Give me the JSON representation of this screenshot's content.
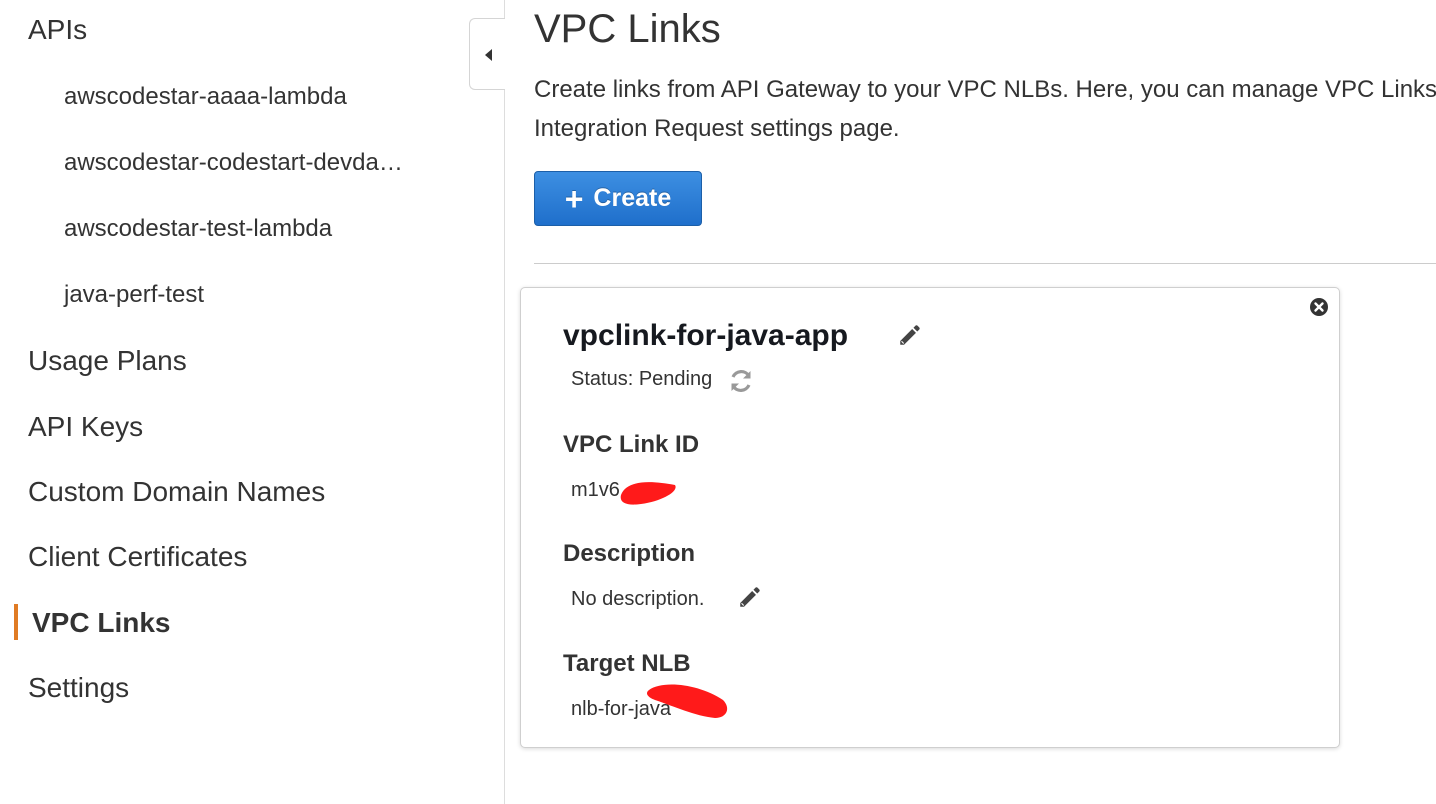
{
  "sidebar": {
    "apis_label": "APIs",
    "apis": [
      "awscodestar-aaaa-lambda",
      "awscodestar-codestart-devda…",
      "awscodestar-test-lambda",
      "java-perf-test"
    ],
    "usage_plans": "Usage Plans",
    "api_keys": "API Keys",
    "custom_domain_names": "Custom Domain Names",
    "client_certificates": "Client Certificates",
    "vpc_links": "VPC Links",
    "settings": "Settings"
  },
  "main": {
    "title": "VPC Links",
    "description_line1": "Create links from API Gateway to your VPC NLBs. Here, you can manage VPC Links",
    "description_line2": "Integration Request settings page.",
    "create_label": "Create",
    "create_icon": "plus-icon"
  },
  "vpc_link": {
    "name": "vpclink-for-java-app",
    "status": "Status: Pending",
    "id_label": "VPC Link ID",
    "id_value": "m1v6",
    "description_label": "Description",
    "description_value": "No description.",
    "target_label": "Target NLB",
    "target_value": "nlb-for-java"
  },
  "colors": {
    "active_accent": "#e07b24",
    "primary_button": "#1f6fcb",
    "redaction": "#ff1a1a"
  },
  "icons": {
    "collapse": "chevron-left-icon",
    "edit": "pencil-icon",
    "close": "close-icon",
    "status": "refresh-icon"
  }
}
